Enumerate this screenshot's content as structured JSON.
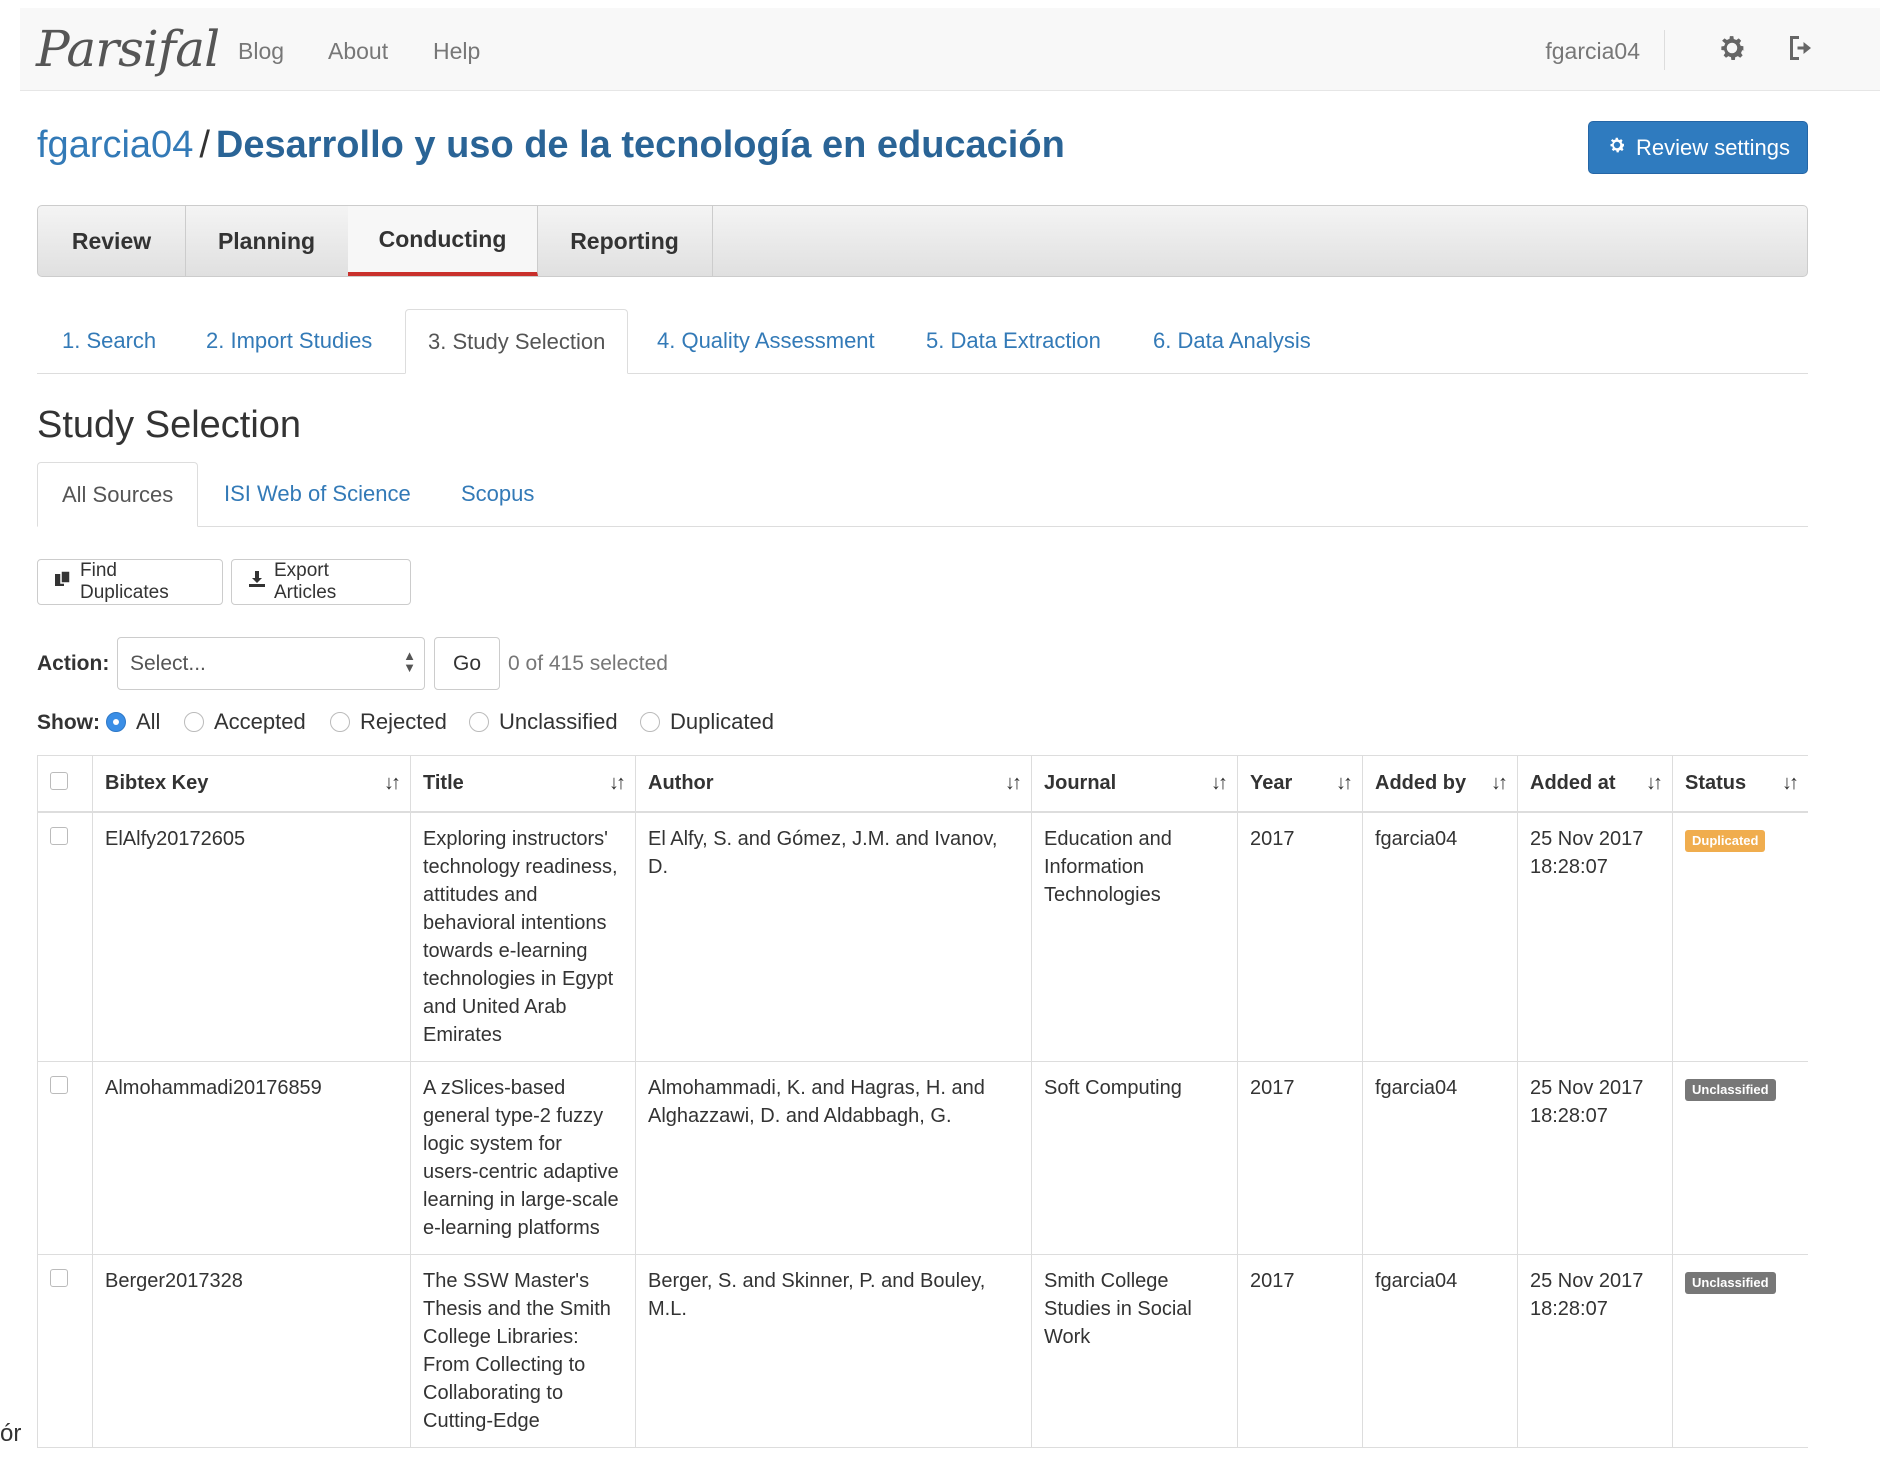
{
  "navbar": {
    "brand": "Parsifal",
    "links": [
      "Blog",
      "About",
      "Help"
    ],
    "user": "fgarcia04",
    "icons": [
      "gear-icon",
      "sign-out-icon"
    ]
  },
  "header": {
    "owner": "fgarcia04",
    "separator": "/",
    "review_name": "Desarrollo y uso de la tecnología en educación",
    "review_settings_label": "Review settings"
  },
  "main_tabs": [
    "Review",
    "Planning",
    "Conducting",
    "Reporting"
  ],
  "active_main_tab": "Conducting",
  "step_tabs": [
    "1. Search",
    "2. Import Studies",
    "3. Study Selection",
    "4. Quality Assessment",
    "5. Data Extraction",
    "6. Data Analysis"
  ],
  "active_step_tab": "3. Study Selection",
  "section_title": "Study Selection",
  "source_tabs": [
    "All Sources",
    "ISI Web of Science",
    "Scopus"
  ],
  "active_source_tab": "All Sources",
  "toolbar": {
    "find_duplicates": "Find Duplicates",
    "export_articles": "Export Articles"
  },
  "action": {
    "label": "Action:",
    "select_value": "Select...",
    "go": "Go",
    "selected_count": "0 of 415 selected"
  },
  "show": {
    "label": "Show:",
    "options": [
      "All",
      "Accepted",
      "Rejected",
      "Unclassified",
      "Duplicated"
    ],
    "selected": "All"
  },
  "table": {
    "headers": [
      "Bibtex Key",
      "Title",
      "Author",
      "Journal",
      "Year",
      "Added by",
      "Added at",
      "Status"
    ],
    "rows": [
      {
        "key": "ElAlfy20172605",
        "title": "Exploring instructors' technology readiness, attitudes and behavioral intentions towards e-learning technologies in Egypt and United Arab Emirates",
        "author": "El Alfy, S. and Gómez, J.M. and Ivanov, D.",
        "journal": "Education and Information Technologies",
        "year": "2017",
        "added_by": "fgarcia04",
        "added_at_date": "25 Nov 2017",
        "added_at_time": "18:28:07",
        "status": "Duplicated"
      },
      {
        "key": "Almohammadi20176859",
        "title": "A zSlices-based general type-2 fuzzy logic system for users-centric adaptive learning in large-scale e-learning platforms",
        "author": "Almohammadi, K. and Hagras, H. and Alghazzawi, D. and Aldabbagh, G.",
        "journal": "Soft Computing",
        "year": "2017",
        "added_by": "fgarcia04",
        "added_at_date": "25 Nov 2017",
        "added_at_time": "18:28:07",
        "status": "Unclassified"
      },
      {
        "key": "Berger2017328",
        "title": "The SSW Master's Thesis and the Smith College Libraries: From Collecting to Collaborating to Cutting-Edge",
        "author": "Berger, S. and Skinner, P. and Bouley, M.L.",
        "journal": "Smith College Studies in Social Work",
        "year": "2017",
        "added_by": "fgarcia04",
        "added_at_date": "25 Nov 2017",
        "added_at_time": "18:28:07",
        "status": "Unclassified"
      }
    ]
  },
  "edge_text": "ór",
  "colors": {
    "link": "#337ab7",
    "primary": "#2f7bbf",
    "active_tab_underline": "#c9302c",
    "badge_duplicated": "#f0ad4e",
    "badge_unclassified": "#777777"
  }
}
